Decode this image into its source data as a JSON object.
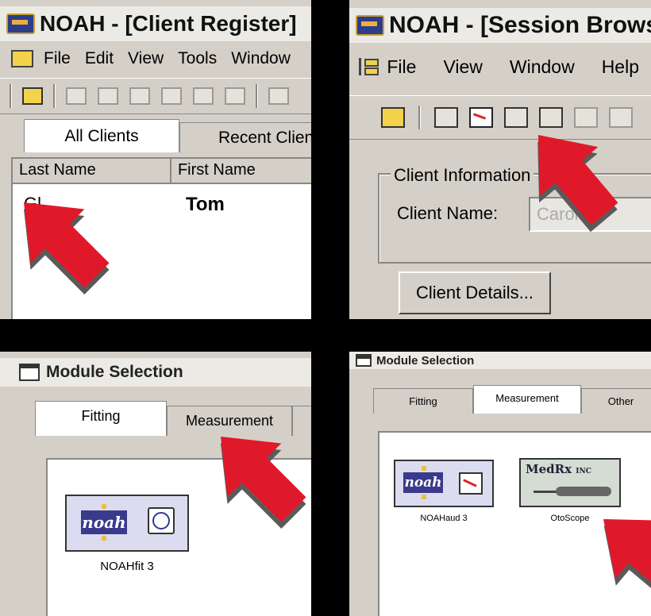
{
  "colors": {
    "arrow": "#e0192a",
    "arrow_shadow": "#5a5a5a",
    "window": "#d4d0c8",
    "divider": "#000000",
    "noah_blue": "#3a3a8c"
  },
  "client_register": {
    "title": "NOAH - [Client Register]",
    "menu": [
      "File",
      "Edit",
      "View",
      "Tools",
      "Window"
    ],
    "tabs": [
      "All Clients",
      "Recent Clients"
    ],
    "columns": [
      "Last Name",
      "First Name"
    ],
    "row": {
      "last_name": "Gl",
      "first_name": "Tom"
    }
  },
  "session_browser": {
    "title": "NOAH - [Session Browser]",
    "menu": [
      "File",
      "View",
      "Window",
      "Help"
    ],
    "group_label": "Client Information",
    "client_name_label": "Client Name:",
    "client_name_value": "Carol",
    "details_button": "Client Details..."
  },
  "module_left": {
    "title": "Module Selection",
    "tabs": [
      "Fitting",
      "Measurement"
    ],
    "selected_tab": "Fitting",
    "module": {
      "logo": "noah",
      "label": "NOAHfit 3",
      "icon": "dial-icon"
    }
  },
  "module_right": {
    "title": "Module Selection",
    "tabs": [
      "Fitting",
      "Measurement",
      "Other"
    ],
    "selected_tab": "Measurement",
    "modules": [
      {
        "logo": "noah",
        "label": "NOAHaud 3",
        "icon": "audiogram-icon"
      },
      {
        "brand": "MedRx",
        "brand_suffix": "INC",
        "label": "OtoScope",
        "icon": "otoscope-icon"
      }
    ]
  }
}
